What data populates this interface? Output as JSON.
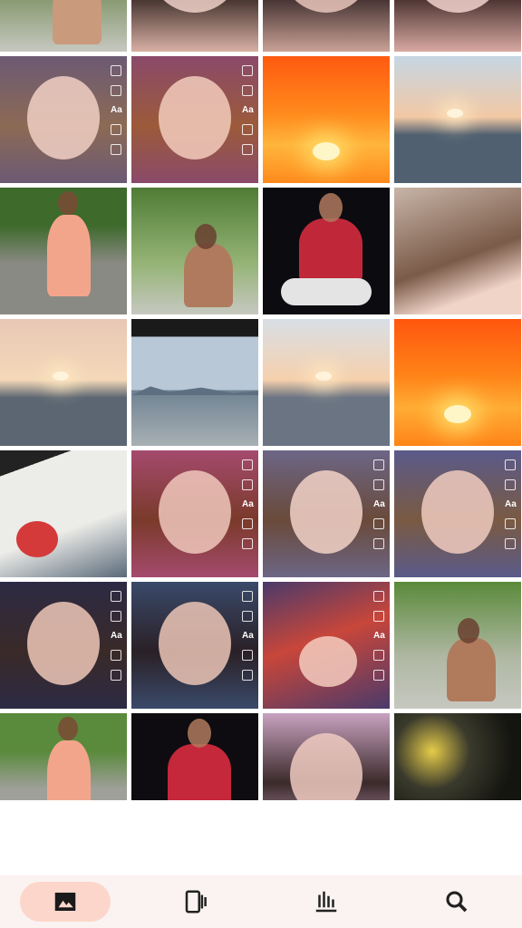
{
  "gallery": {
    "tiles": [
      {
        "kind": "person-outdoor",
        "colors": [
          "#4c6c3e",
          "#8a9c74",
          "#c99a7c"
        ]
      },
      {
        "kind": "face-close",
        "colors": [
          "#d8b0a4",
          "#3a2a26",
          "#efd0c8"
        ]
      },
      {
        "kind": "face-close",
        "colors": [
          "#caa296",
          "#3a2a2a",
          "#e9c6bc"
        ]
      },
      {
        "kind": "face-close",
        "colors": [
          "#d9a9a3",
          "#402a28",
          "#f2d2cd"
        ]
      },
      {
        "kind": "face-portrait",
        "colors": [
          "#6c5a74",
          "#8c6a54",
          "#f1d0c4"
        ]
      },
      {
        "kind": "face-portrait",
        "colors": [
          "#8a4a6a",
          "#9c5a3a",
          "#f3cdbd"
        ]
      },
      {
        "kind": "sunset-clouds",
        "colors": [
          "#ff8a1c",
          "#ffb53c",
          "#ff5a10"
        ]
      },
      {
        "kind": "sea-sunset",
        "colors": [
          "#c6d6e4",
          "#f2c8a4",
          "#506070"
        ]
      },
      {
        "kind": "person-road",
        "colors": [
          "#3e6a2c",
          "#8a8a84",
          "#f3a58c"
        ]
      },
      {
        "kind": "person-forest",
        "colors": [
          "#4f7c35",
          "#95b476",
          "#b07a5e"
        ]
      },
      {
        "kind": "person-dark-bike",
        "colors": [
          "#0c0c10",
          "#c0283a",
          "#e4e4e4"
        ]
      },
      {
        "kind": "hair-close",
        "colors": [
          "#c8b5a8",
          "#7a5a48",
          "#f0d4c8"
        ]
      },
      {
        "kind": "sea-sunset",
        "colors": [
          "#e8c8b6",
          "#f4d8b8",
          "#5c6672"
        ]
      },
      {
        "kind": "sea-mountains",
        "colors": [
          "#b8c8d6",
          "#6f8292",
          "#a8b0b4"
        ]
      },
      {
        "kind": "sea-sunset",
        "colors": [
          "#d8dfe6",
          "#f6d0ac",
          "#6a7482"
        ]
      },
      {
        "kind": "sunset-clouds",
        "colors": [
          "#ff8418",
          "#ffac34",
          "#ff560e"
        ]
      },
      {
        "kind": "tilted-room",
        "colors": [
          "#ecece8",
          "#5a6a7a",
          "#d43a3a"
        ]
      },
      {
        "kind": "face-portrait",
        "colors": [
          "#a54a6e",
          "#7a3a2a",
          "#f0c8bc"
        ]
      },
      {
        "kind": "face-portrait",
        "colors": [
          "#6c6686",
          "#6a4a3a",
          "#f2d2c8"
        ]
      },
      {
        "kind": "face-portrait",
        "colors": [
          "#5a5a8a",
          "#7a5a42",
          "#f0cbbf"
        ]
      },
      {
        "kind": "face-portrait",
        "colors": [
          "#2c2a44",
          "#3a2a28",
          "#f0c8b8"
        ]
      },
      {
        "kind": "face-portrait",
        "colors": [
          "#3a4a6a",
          "#2a2026",
          "#ecc6b6"
        ]
      },
      {
        "kind": "face-lying",
        "colors": [
          "#4a3a6a",
          "#c8463a",
          "#f4ccc0"
        ]
      },
      {
        "kind": "person-rocks",
        "colors": [
          "#5a8a3a",
          "#b0b8a4",
          "#b07a5c"
        ]
      },
      {
        "kind": "person-road",
        "colors": [
          "#5a8a3c",
          "#a0a09a",
          "#f3a58c"
        ]
      },
      {
        "kind": "person-dark-bike",
        "colors": [
          "#0e0c10",
          "#c4283a",
          "#e8e8e8"
        ]
      },
      {
        "kind": "face-close-pink",
        "colors": [
          "#c8a2c0",
          "#3a2a2a",
          "#eecac0"
        ]
      },
      {
        "kind": "night-scene",
        "colors": [
          "#141410",
          "#e6cc4a",
          "#3a3a2c"
        ]
      },
      {
        "kind": "partial",
        "colors": [
          "#4a7a3a",
          "#e8e8e4",
          "#6a6a64"
        ]
      },
      {
        "kind": "partial",
        "colors": [
          "#d8d4d8",
          "#a4a0a8",
          "#e8e4e8"
        ]
      },
      {
        "kind": "partial",
        "colors": [
          "#e4d8dc",
          "#8a4a5a",
          "#c0a4ac"
        ]
      },
      {
        "kind": "partial",
        "colors": [
          "#f0ecf0",
          "#7a5a7a",
          "#b4a0c0"
        ]
      }
    ]
  },
  "nav": {
    "items": [
      {
        "name": "nav-photos",
        "icon": "image-icon",
        "active": true
      },
      {
        "name": "nav-videos",
        "icon": "video-clips-icon",
        "active": false
      },
      {
        "name": "nav-albums",
        "icon": "library-icon",
        "active": false
      },
      {
        "name": "nav-search",
        "icon": "search-icon",
        "active": false
      }
    ],
    "accent": "#fdd6cb",
    "background": "#fbf3f1"
  }
}
